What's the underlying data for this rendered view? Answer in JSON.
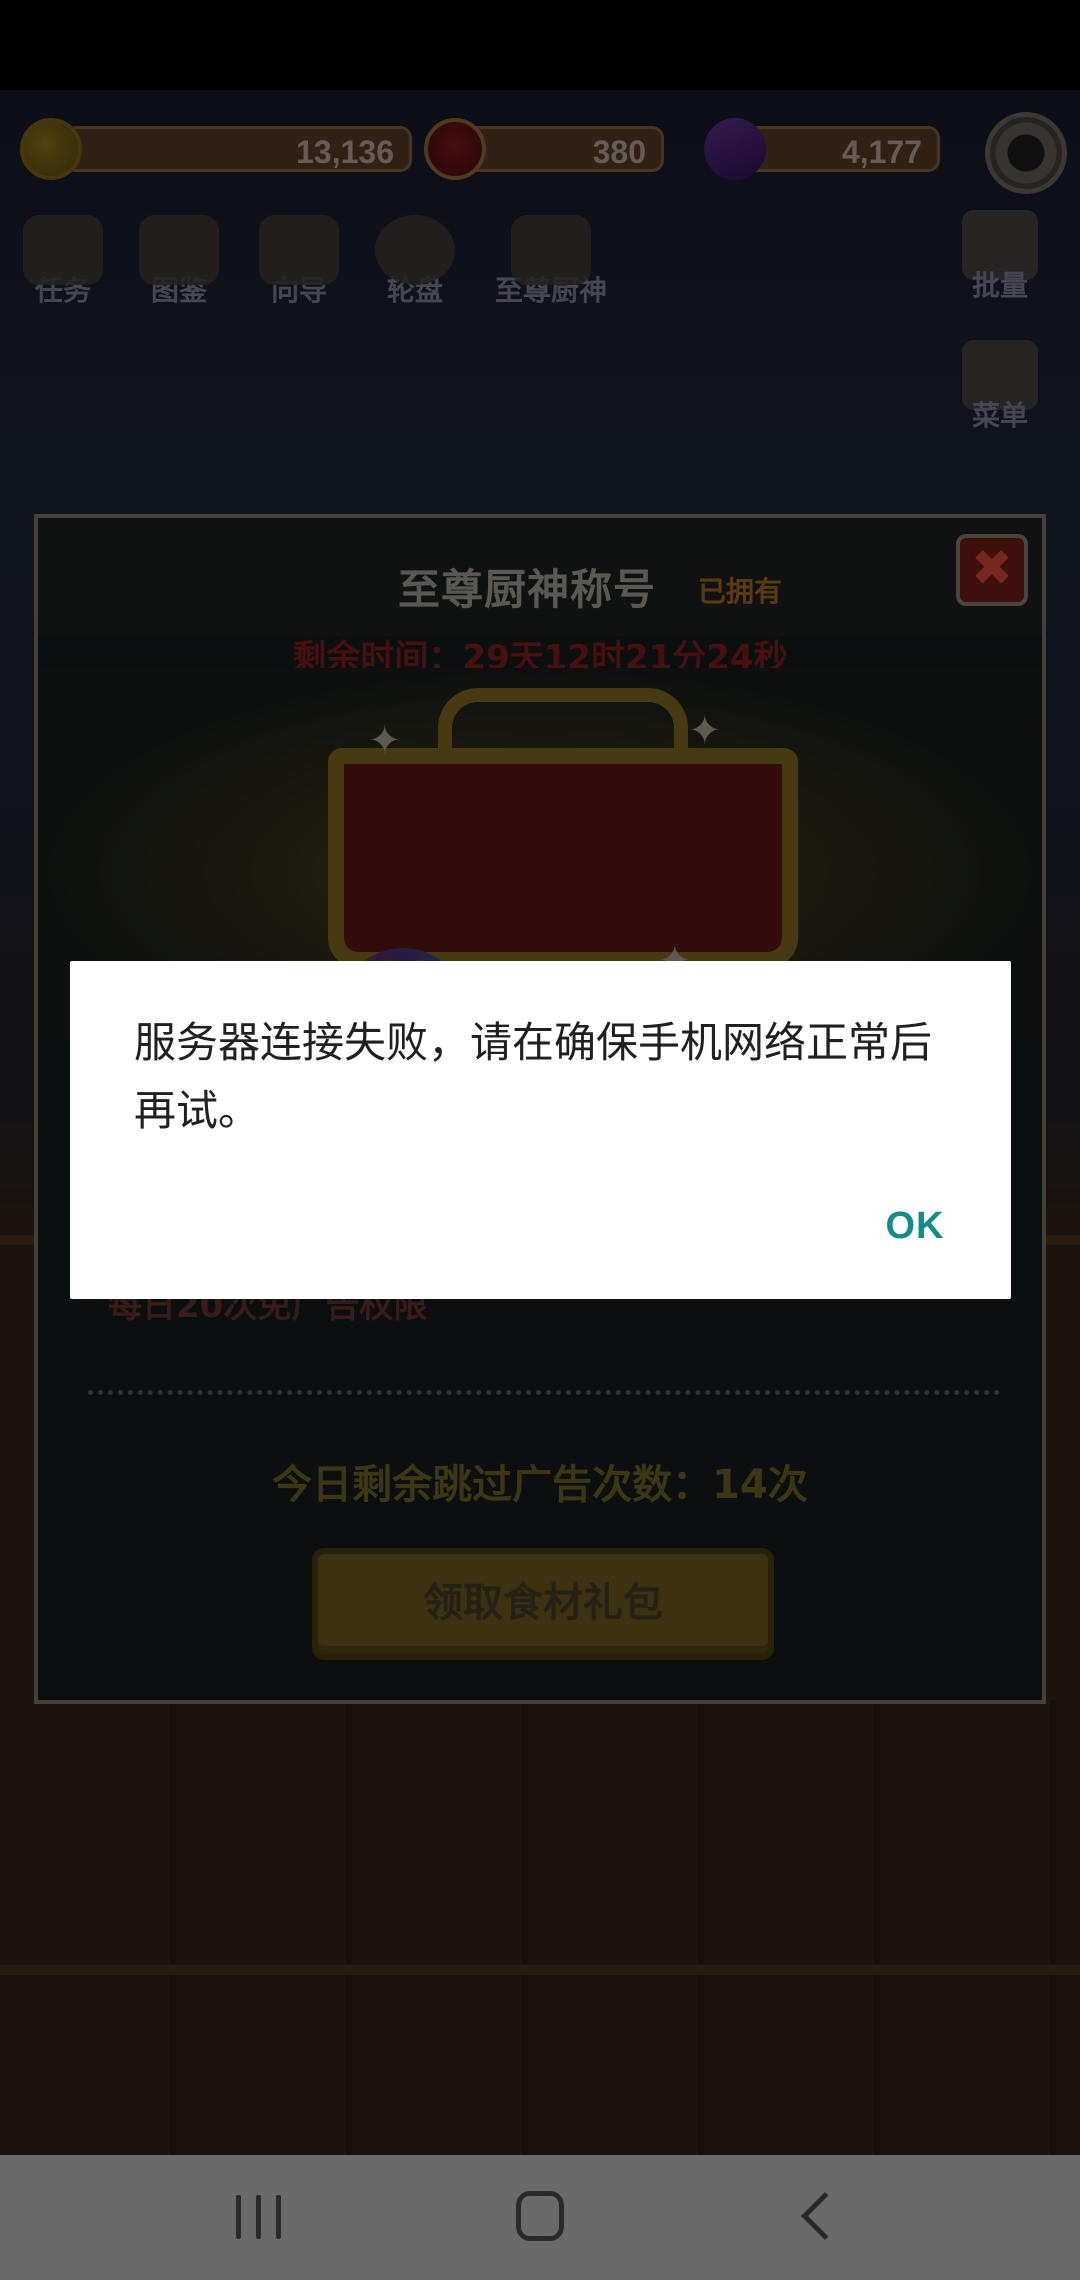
{
  "resources": {
    "coins": "13,136",
    "medals": "380",
    "gems": "4,177"
  },
  "nav": {
    "items": [
      {
        "label": "任务",
        "icon": "task-icon"
      },
      {
        "label": "图鉴",
        "icon": "book-icon"
      },
      {
        "label": "向导",
        "icon": "signpost-icon"
      },
      {
        "label": "轮盘",
        "icon": "wheel-icon"
      },
      {
        "label": "至尊厨神",
        "icon": "chef-icon"
      }
    ],
    "side": [
      {
        "label": "批量",
        "icon": "bird-icon"
      },
      {
        "label": "菜单",
        "icon": "menu-icon"
      }
    ]
  },
  "panel": {
    "title": "至尊厨神称号",
    "owned": "已拥有",
    "timer": "剩余时间：29天12时21分24秒",
    "perk": "每日20次免广告权限",
    "skip_count": "今日剩余跳过广告次数：14次",
    "claim_button": "领取食材礼包",
    "close_symbol": "✖"
  },
  "dialog": {
    "message": "服务器连接失败，请在确保手机网络正常后再试。",
    "ok_label": "OK"
  },
  "colors": {
    "dialog_accent": "#0f8f8a",
    "navbar": "#6a6a6a"
  }
}
